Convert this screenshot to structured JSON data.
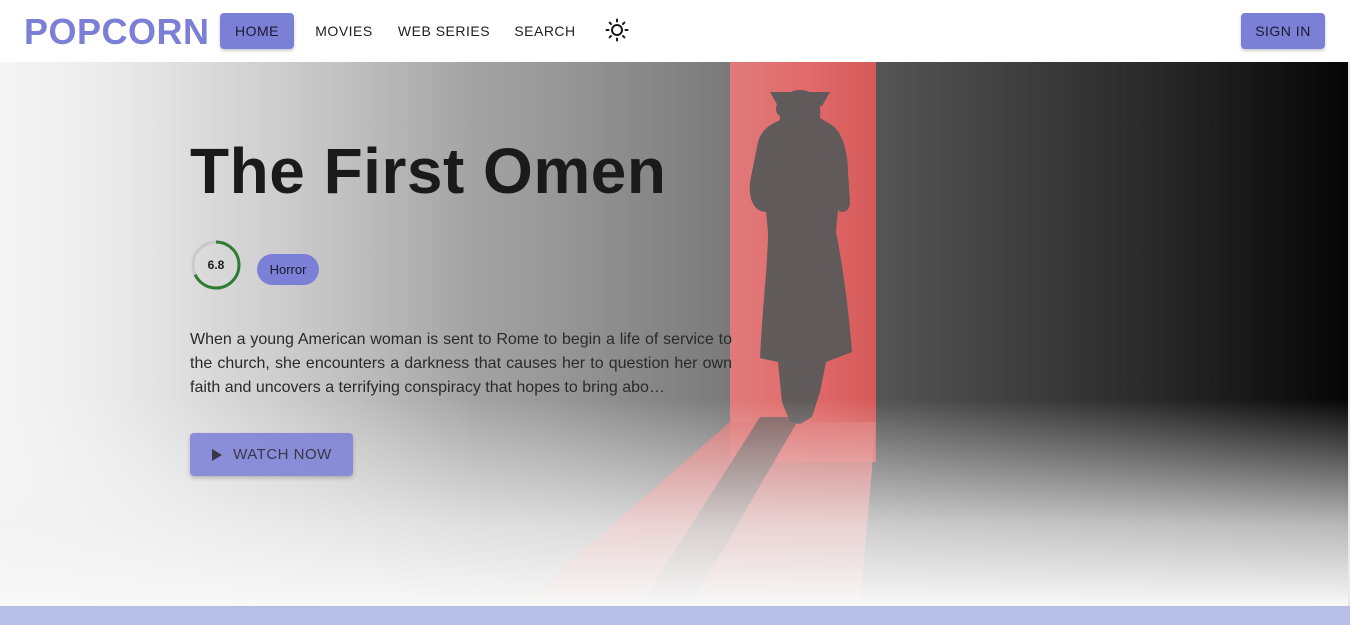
{
  "brand": {
    "name": "POPCORN",
    "accent": "#7b7fd6"
  },
  "nav": {
    "home": "HOME",
    "movies": "MOVIES",
    "web_series": "WEB SERIES",
    "search": "SEARCH",
    "theme_icon": "sun-icon",
    "sign_in": "SIGN IN"
  },
  "hero": {
    "title": "The First Omen",
    "rating": "6.8",
    "rating_fraction": 0.68,
    "genre": "Horror",
    "description": "When a young American woman is sent to Rome to begin a life of service to the church, she encounters a darkness that causes her to question her own faith and uncovers a terrifying conspiracy that hopes to bring abo…",
    "watch_label": "WATCH NOW",
    "play_icon": "play-icon"
  }
}
